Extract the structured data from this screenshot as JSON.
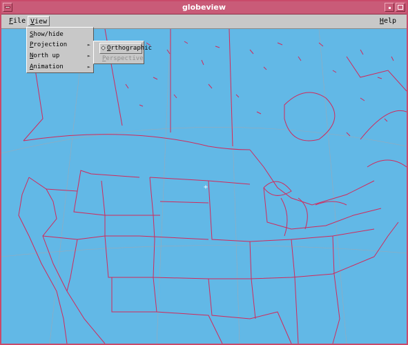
{
  "window": {
    "title": "globeview"
  },
  "menubar": {
    "file": {
      "label": "File",
      "mnemonic": "F",
      "rest": "ile"
    },
    "view": {
      "label": "View",
      "mnemonic": "V",
      "rest": "iew"
    },
    "help": {
      "label": "Help",
      "mnemonic": "H",
      "rest": "elp"
    }
  },
  "view_menu": {
    "items": [
      {
        "label": "Show/hide Maps...",
        "mnemonic": "S",
        "rest": "how/hide Maps...",
        "has_submenu": false
      },
      {
        "label": "Projection",
        "mnemonic": "P",
        "rest": "rojection",
        "has_submenu": true
      },
      {
        "label": "North up",
        "mnemonic": "N",
        "rest": "orth up",
        "has_submenu": true
      },
      {
        "label": "Animation",
        "mnemonic": "A",
        "rest": "nimation",
        "has_submenu": true
      }
    ],
    "submenu_arrow": "►"
  },
  "projection_submenu": {
    "items": [
      {
        "label": "Orthographic",
        "mnemonic": "O",
        "rest": "rthographic",
        "selected": true,
        "enabled": true
      },
      {
        "label": "Perspective",
        "mnemonic": "P",
        "rest": "erspective",
        "selected": false,
        "enabled": false
      }
    ]
  },
  "map": {
    "background_color": "#62b8e6",
    "border_color": "#d2285a",
    "graticule_color": "#9aa9b8",
    "cursor": "+"
  }
}
